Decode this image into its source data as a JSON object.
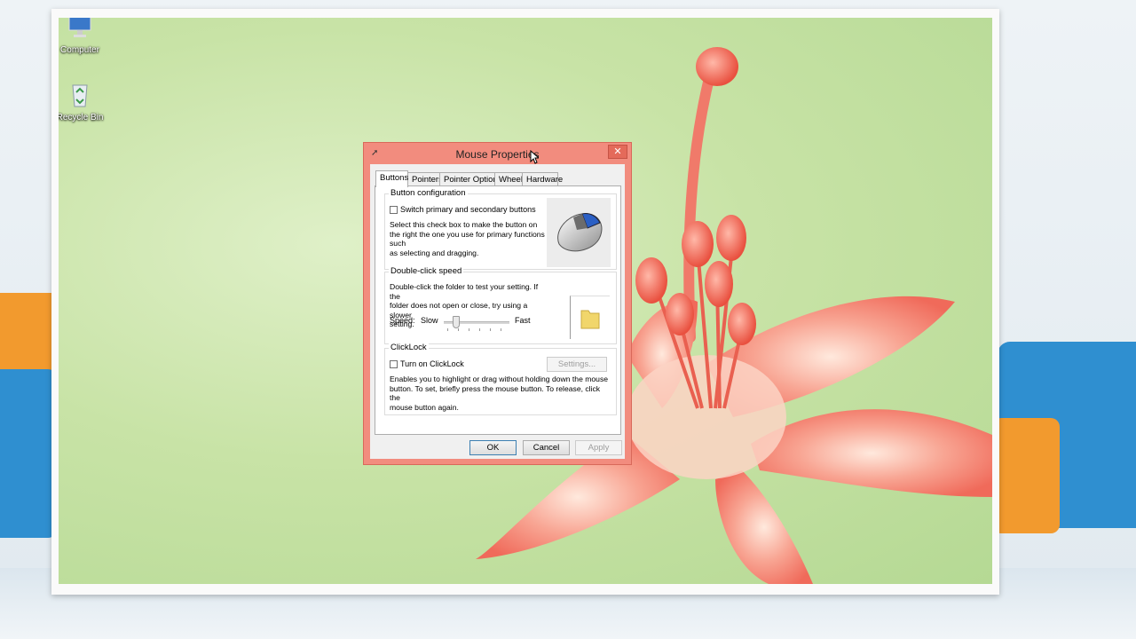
{
  "desktop": {
    "icons": [
      {
        "label": "Computer",
        "icon": "computer-icon"
      },
      {
        "label": "Recycle Bin",
        "icon": "recycle-bin-icon"
      }
    ]
  },
  "dialog": {
    "title": "Mouse Properties",
    "close_symbol": "✕",
    "accent_color": "#f28c7e",
    "tabs": [
      "Buttons",
      "Pointers",
      "Pointer Options",
      "Wheel",
      "Hardware"
    ],
    "active_tab": "Buttons",
    "button_config": {
      "title": "Button configuration",
      "checkbox_label": "Switch primary and secondary buttons",
      "checked": false,
      "description_lines": [
        "Select this check box to make the button on",
        "the right the one you use for primary functions such",
        "as selecting and dragging."
      ]
    },
    "double_click": {
      "title": "Double-click speed",
      "description_lines": [
        "Double-click the folder to test your setting. If the",
        "folder does not open or close, try using a slower",
        "setting."
      ],
      "speed_label": "Speed:",
      "slow_label": "Slow",
      "fast_label": "Fast",
      "speed_fraction": 0.15
    },
    "clicklock": {
      "title": "ClickLock",
      "checkbox_label": "Turn on ClickLock",
      "checked": false,
      "settings_button": "Settings...",
      "description_lines": [
        "Enables you to highlight or drag without holding down the mouse",
        "button. To set, briefly press the mouse button. To release, click the",
        "mouse button again."
      ]
    },
    "buttons": {
      "ok": "OK",
      "cancel": "Cancel",
      "apply": "Apply"
    }
  }
}
